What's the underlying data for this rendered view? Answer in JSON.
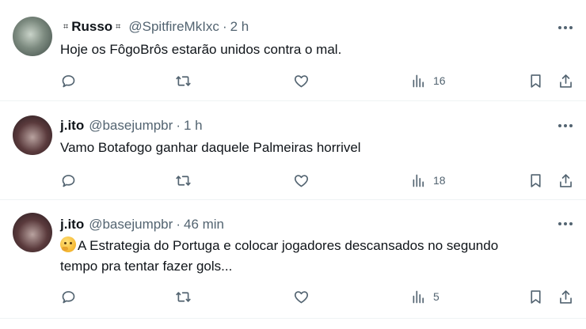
{
  "tweets": [
    {
      "name": "Russo",
      "name_marks": [
        "⌗",
        "⌗"
      ],
      "handle": "@SpitfireMkIxc",
      "separator": "·",
      "time": "2 h",
      "text": "Hoje os FôgoBrôs estarão unidos contra o mal.",
      "text_line2": "",
      "views": "16"
    },
    {
      "name": "j.ito",
      "handle": "@basejumpbr",
      "separator": "·",
      "time": "1 h",
      "text": "Vamo Botafogo ganhar daquele Palmeiras horrivel",
      "text_line2": "",
      "views": "18"
    },
    {
      "name": "j.ito",
      "handle": "@basejumpbr",
      "separator": "·",
      "time": "46 min",
      "emoji": "thinking-face-emoji",
      "text": "A Estrategia do Portuga e colocar jogadores descansados no segundo",
      "text_line2": "tempo pra tentar fazer gols...",
      "views": "5"
    }
  ],
  "icons": [
    "reply-icon",
    "retweet-icon",
    "like-icon",
    "views-icon",
    "bookmark-icon",
    "share-icon",
    "more-icon"
  ],
  "colors": {
    "text": "#0f1419",
    "secondary": "#536471",
    "divider": "#eff3f4"
  }
}
